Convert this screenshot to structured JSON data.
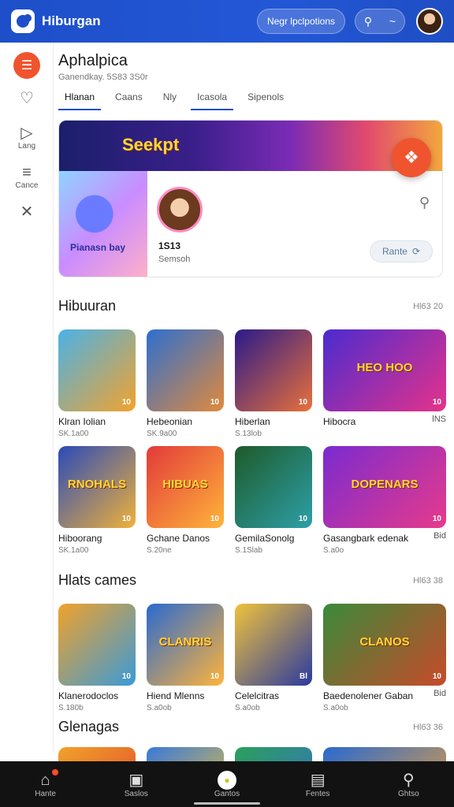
{
  "header": {
    "app_title": "Hiburgan",
    "pill_label": "Negr lpclpotions",
    "search_icon": "search-icon",
    "chevron": "~"
  },
  "rail": [
    {
      "icon": "menu-icon",
      "label": ""
    },
    {
      "icon": "heart-icon",
      "label": ""
    },
    {
      "icon": "play-icon",
      "label": "Lang"
    },
    {
      "icon": "grid-icon",
      "label": "Cance"
    },
    {
      "icon": "cross-icon",
      "label": ""
    }
  ],
  "page": {
    "title": "Aphalpica",
    "subtitle": "Ganendkay. 5S83 3S0r",
    "tabs": [
      "Hlanan",
      "Caans",
      "Nly",
      "Icasola",
      "Sipenols"
    ]
  },
  "feature": {
    "banner_text": "Seekpt",
    "art_text": "Pianasn bay",
    "name": "1S13",
    "meta": "Semsoh",
    "button_label": "Rante"
  },
  "sections": [
    {
      "title": "Hibuuran",
      "link": "Hl63 20",
      "cards": [
        {
          "title": "Klran Iolian",
          "meta": "SK.1a00",
          "badge": "10",
          "label": "",
          "colors": [
            "#4ab2e8",
            "#f2a32c"
          ]
        },
        {
          "title": "Hebeonian",
          "meta": "SK.9a00",
          "badge": "10",
          "label": "",
          "colors": [
            "#2d6fd0",
            "#e08a3c"
          ]
        },
        {
          "title": "Hiberlan",
          "meta": "S.13lob",
          "badge": "10",
          "label": "",
          "colors": [
            "#2a1a8a",
            "#e8703a"
          ]
        },
        {
          "title": "Hibocra",
          "meta": "",
          "badge": "10",
          "label": "HEO HOO",
          "side": "lNS",
          "colors": [
            "#4a2bd0",
            "#e6328a"
          ]
        }
      ]
    },
    {
      "title": "",
      "link": "",
      "cards": [
        {
          "title": "Hiboorang",
          "meta": "SK.1a00",
          "badge": "10",
          "label": "RNOHALS",
          "colors": [
            "#2a4ab8",
            "#f0b23a"
          ]
        },
        {
          "title": "Gchane Danos",
          "meta": "S.20ne",
          "badge": "10",
          "label": "HIBUAS",
          "colors": [
            "#e23a3a",
            "#ffb43a"
          ]
        },
        {
          "title": "GemilaSonolg",
          "meta": "S.1Slab",
          "badge": "10",
          "label": "",
          "colors": [
            "#1e5a2a",
            "#2da0a8"
          ]
        },
        {
          "title": "Gasangbark edenak",
          "meta": "S.a0o",
          "badge": "10",
          "label": "DOPENARS",
          "side": "Bid",
          "colors": [
            "#7a2bd0",
            "#e83a8a"
          ]
        }
      ]
    },
    {
      "title": "Hlats cames",
      "link": "Hl63 38",
      "cards": [
        {
          "title": "Klanerodoclos",
          "meta": "S.180b",
          "badge": "10",
          "label": "",
          "colors": [
            "#f0a22a",
            "#3a9ad8"
          ]
        },
        {
          "title": "Hiend Mlenns",
          "meta": "S.a0ob",
          "badge": "10",
          "label": "CLANRIS",
          "colors": [
            "#2a6ad0",
            "#ffb43a"
          ]
        },
        {
          "title": "Celelcitras",
          "meta": "S.a0ob",
          "badge": "Bl",
          "label": "",
          "colors": [
            "#f0c23a",
            "#2a3aa0"
          ]
        },
        {
          "title": "Baedenolener Gaban",
          "meta": "S.a0ob",
          "badge": "10",
          "label": "CLANOS",
          "side": "Bid",
          "colors": [
            "#3a8a3a",
            "#c84a2a"
          ]
        }
      ]
    },
    {
      "title": "Glenagas",
      "link": "Hl63 36",
      "cards": []
    }
  ],
  "bottom_nav": [
    {
      "icon": "home-icon",
      "label": "Hante"
    },
    {
      "icon": "gamepad-icon",
      "label": "Saslos"
    },
    {
      "icon": "play-icon",
      "label": "Gantos"
    },
    {
      "icon": "book-icon",
      "label": "Fentes"
    },
    {
      "icon": "search-icon",
      "label": "Ghtso"
    }
  ]
}
